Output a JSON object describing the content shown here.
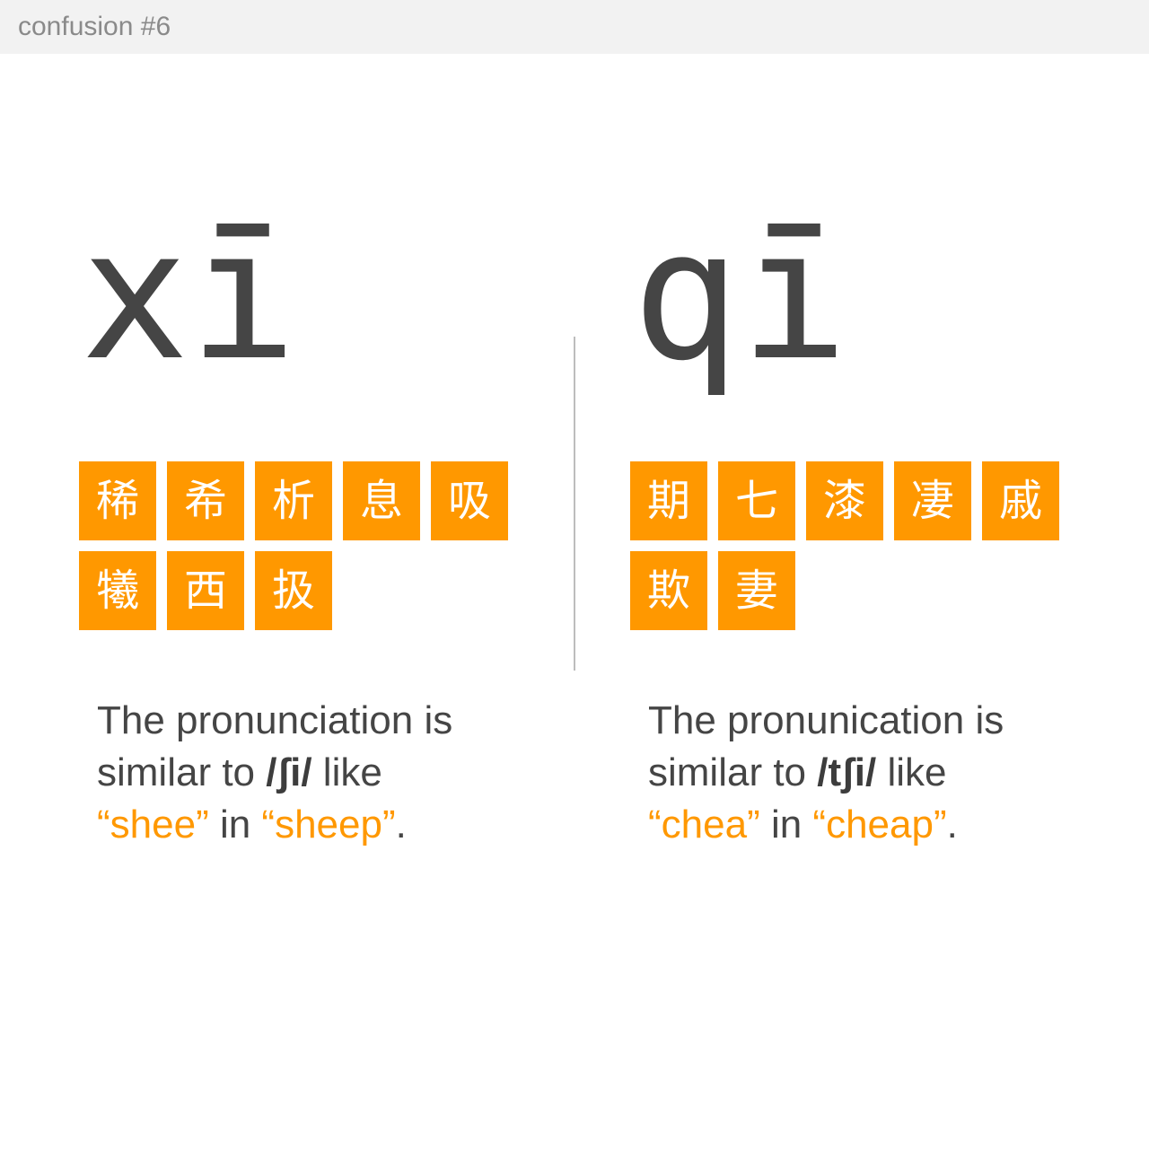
{
  "header": {
    "title": "confusion #6"
  },
  "left": {
    "syllable": "xī",
    "characters": [
      "稀",
      "希",
      "析",
      "息",
      "吸",
      "犧",
      "西",
      "扱"
    ],
    "description": {
      "line1": "The pronunciation is",
      "prefix": "similar to ",
      "ipa": "/ʃi/",
      "suffix": " like",
      "quote1": "“shee”",
      "middle": " in ",
      "quote2": "“sheep”",
      "end": "."
    }
  },
  "right": {
    "syllable": "qī",
    "characters": [
      "期",
      "七",
      "漆",
      "凄",
      "戚",
      "欺",
      "妻"
    ],
    "description": {
      "line1": "The pronunication is",
      "prefix": "similar to ",
      "ipa": "/tʃi/",
      "suffix": " like",
      "quote1": "“chea”",
      "middle": " in ",
      "quote2": "“cheap”",
      "end": "."
    }
  },
  "colors": {
    "accent": "#ff9800",
    "text": "#454545",
    "header_bg": "#f2f2f2",
    "header_text": "#8a8a8a",
    "divider": "#bdbdbd"
  }
}
